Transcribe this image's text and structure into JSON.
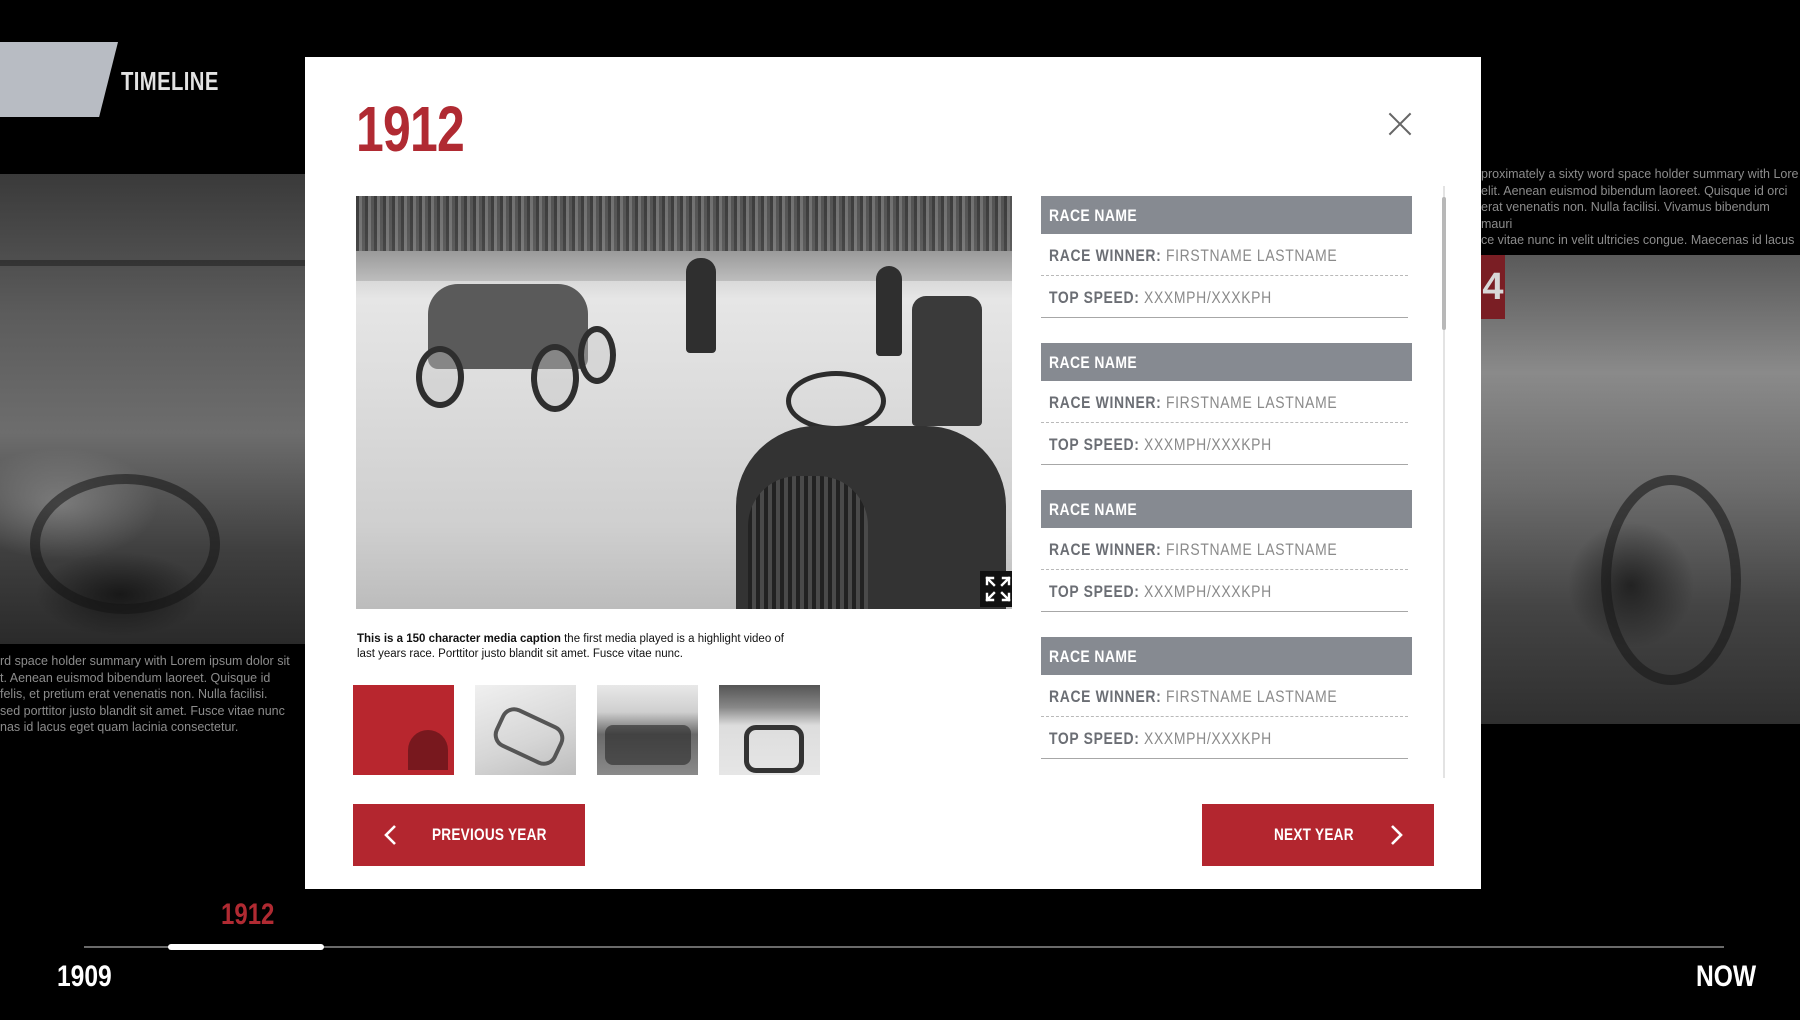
{
  "header": {
    "section_label": "TIMELINE"
  },
  "background": {
    "left_summary": "rd space holder summary with Lorem ipsum dolor sit\nt. Aenean euismod bibendum laoreet. Quisque id\n felis, et pretium erat venenatis non. Nulla facilisi.\n sed porttitor justo blandit sit amet. Fusce vitae nunc\nnas id lacus eget quam lacinia consectetur.",
    "right_summary": "proximately a sixty word space holder summary with Lore\n elit. Aenean euismod bibendum laoreet. Quisque id orci\nerat venenatis non. Nulla facilisi. Vivamus bibendum mauri\nce vitae nunc in velit ultricies congue. Maecenas id lacus",
    "right_badge": "4"
  },
  "modal": {
    "year": "1912",
    "media": {
      "caption_bold": "This is a 150 character media caption",
      "caption_rest": " the first media played is a highlight video of last years race. Porttitor justo blandit sit amet. Fusce vitae nunc."
    },
    "races": [
      {
        "name": "RACE NAME",
        "winner_label": "RACE WINNER:",
        "winner_value": " FIRSTNAME LASTNAME",
        "speed_label": "TOP SPEED:",
        "speed_value": " XXXMPH/XXXKPH"
      },
      {
        "name": "RACE NAME",
        "winner_label": "RACE WINNER:",
        "winner_value": " FIRSTNAME LASTNAME",
        "speed_label": "TOP SPEED:",
        "speed_value": " XXXMPH/XXXKPH"
      },
      {
        "name": "RACE NAME",
        "winner_label": "RACE WINNER:",
        "winner_value": " FIRSTNAME LASTNAME",
        "speed_label": "TOP SPEED:",
        "speed_value": " XXXMPH/XXXKPH"
      },
      {
        "name": "RACE NAME",
        "winner_label": "RACE WINNER:",
        "winner_value": " FIRSTNAME LASTNAME",
        "speed_label": "TOP SPEED:",
        "speed_value": " XXXMPH/XXXKPH"
      }
    ],
    "prev_label": "PREVIOUS YEAR",
    "next_label": "NEXT YEAR"
  },
  "timeline": {
    "current_year": "1912",
    "start_label": "1909",
    "end_label": "NOW"
  },
  "colors": {
    "accent": "#b02a32",
    "race_header": "#868a91"
  },
  "icons": {
    "close": "close-icon",
    "expand": "expand-icon",
    "prev": "chevron-left-icon",
    "next": "chevron-right-icon"
  }
}
